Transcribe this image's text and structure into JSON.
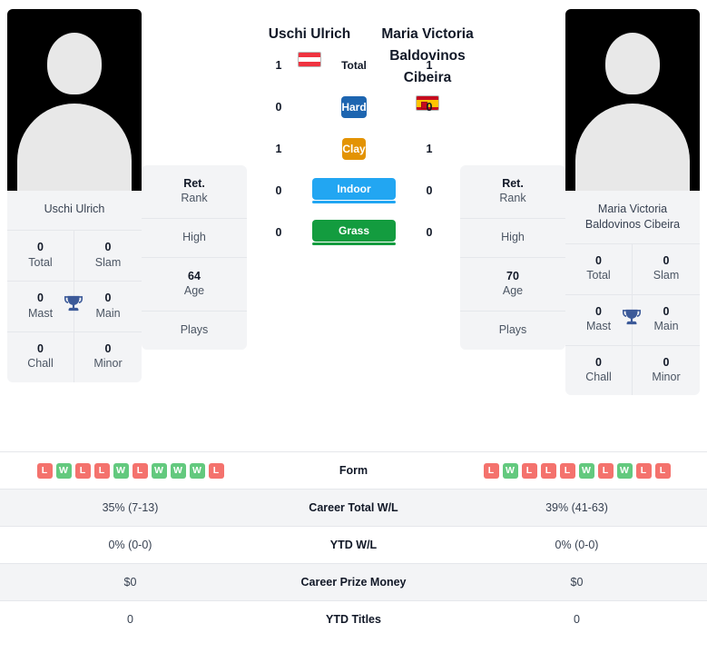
{
  "players": {
    "left": {
      "name": "Uschi Ulrich",
      "name_under": "Uschi Ulrich",
      "flag": "austria-flag-icon",
      "titles": [
        {
          "value": "0",
          "label": "Total"
        },
        {
          "value": "0",
          "label": "Slam"
        },
        {
          "value": "0",
          "label": "Mast"
        },
        {
          "value": "0",
          "label": "Main"
        },
        {
          "value": "0",
          "label": "Chall"
        },
        {
          "value": "0",
          "label": "Minor"
        }
      ],
      "info": [
        {
          "value": "Ret.",
          "label": "Rank"
        },
        {
          "value": "High",
          "label": ""
        },
        {
          "value": "64",
          "label": "Age"
        },
        {
          "value": "Plays",
          "label": ""
        }
      ]
    },
    "right": {
      "name": "Maria Victoria Baldovinos Cibeira",
      "name_under": "Maria Victoria Baldovinos Cibeira",
      "flag": "spain-flag-icon",
      "titles": [
        {
          "value": "0",
          "label": "Total"
        },
        {
          "value": "0",
          "label": "Slam"
        },
        {
          "value": "0",
          "label": "Mast"
        },
        {
          "value": "0",
          "label": "Main"
        },
        {
          "value": "0",
          "label": "Chall"
        },
        {
          "value": "0",
          "label": "Minor"
        }
      ],
      "info": [
        {
          "value": "Ret.",
          "label": "Rank"
        },
        {
          "value": "High",
          "label": ""
        },
        {
          "value": "70",
          "label": "Age"
        },
        {
          "value": "Plays",
          "label": ""
        }
      ]
    }
  },
  "surfaces": [
    {
      "label": "Total",
      "left": "1",
      "right": "1",
      "color": "transparent",
      "key": "total"
    },
    {
      "label": "Hard",
      "left": "0",
      "right": "0",
      "color": "#1d65b0",
      "key": "hard"
    },
    {
      "label": "Clay",
      "left": "1",
      "right": "1",
      "color": "#e39304",
      "key": "clay"
    },
    {
      "label": "Indoor",
      "left": "0",
      "right": "0",
      "color": "#22a6f2",
      "key": "indoor"
    },
    {
      "label": "Grass",
      "left": "0",
      "right": "0",
      "color": "#139c3f",
      "key": "grass"
    }
  ],
  "comparison_rows": [
    {
      "label": "Form",
      "type": "form",
      "left_form": [
        "L",
        "W",
        "L",
        "L",
        "W",
        "L",
        "W",
        "W",
        "W",
        "L"
      ],
      "right_form": [
        "L",
        "W",
        "L",
        "L",
        "L",
        "W",
        "L",
        "W",
        "L",
        "L"
      ]
    },
    {
      "label": "Career Total W/L",
      "type": "text",
      "left": "35% (7-13)",
      "right": "39% (41-63)"
    },
    {
      "label": "YTD W/L",
      "type": "text",
      "left": "0% (0-0)",
      "right": "0% (0-0)"
    },
    {
      "label": "Career Prize Money",
      "type": "text",
      "left": "$0",
      "right": "$0"
    },
    {
      "label": "YTD Titles",
      "type": "text",
      "left": "0",
      "right": "0"
    }
  ],
  "colors": {
    "win": "#63c97e",
    "loss": "#f4726d",
    "panel": "#f3f4f6",
    "border": "#e5e7eb",
    "trophy": "#3c5a99"
  }
}
